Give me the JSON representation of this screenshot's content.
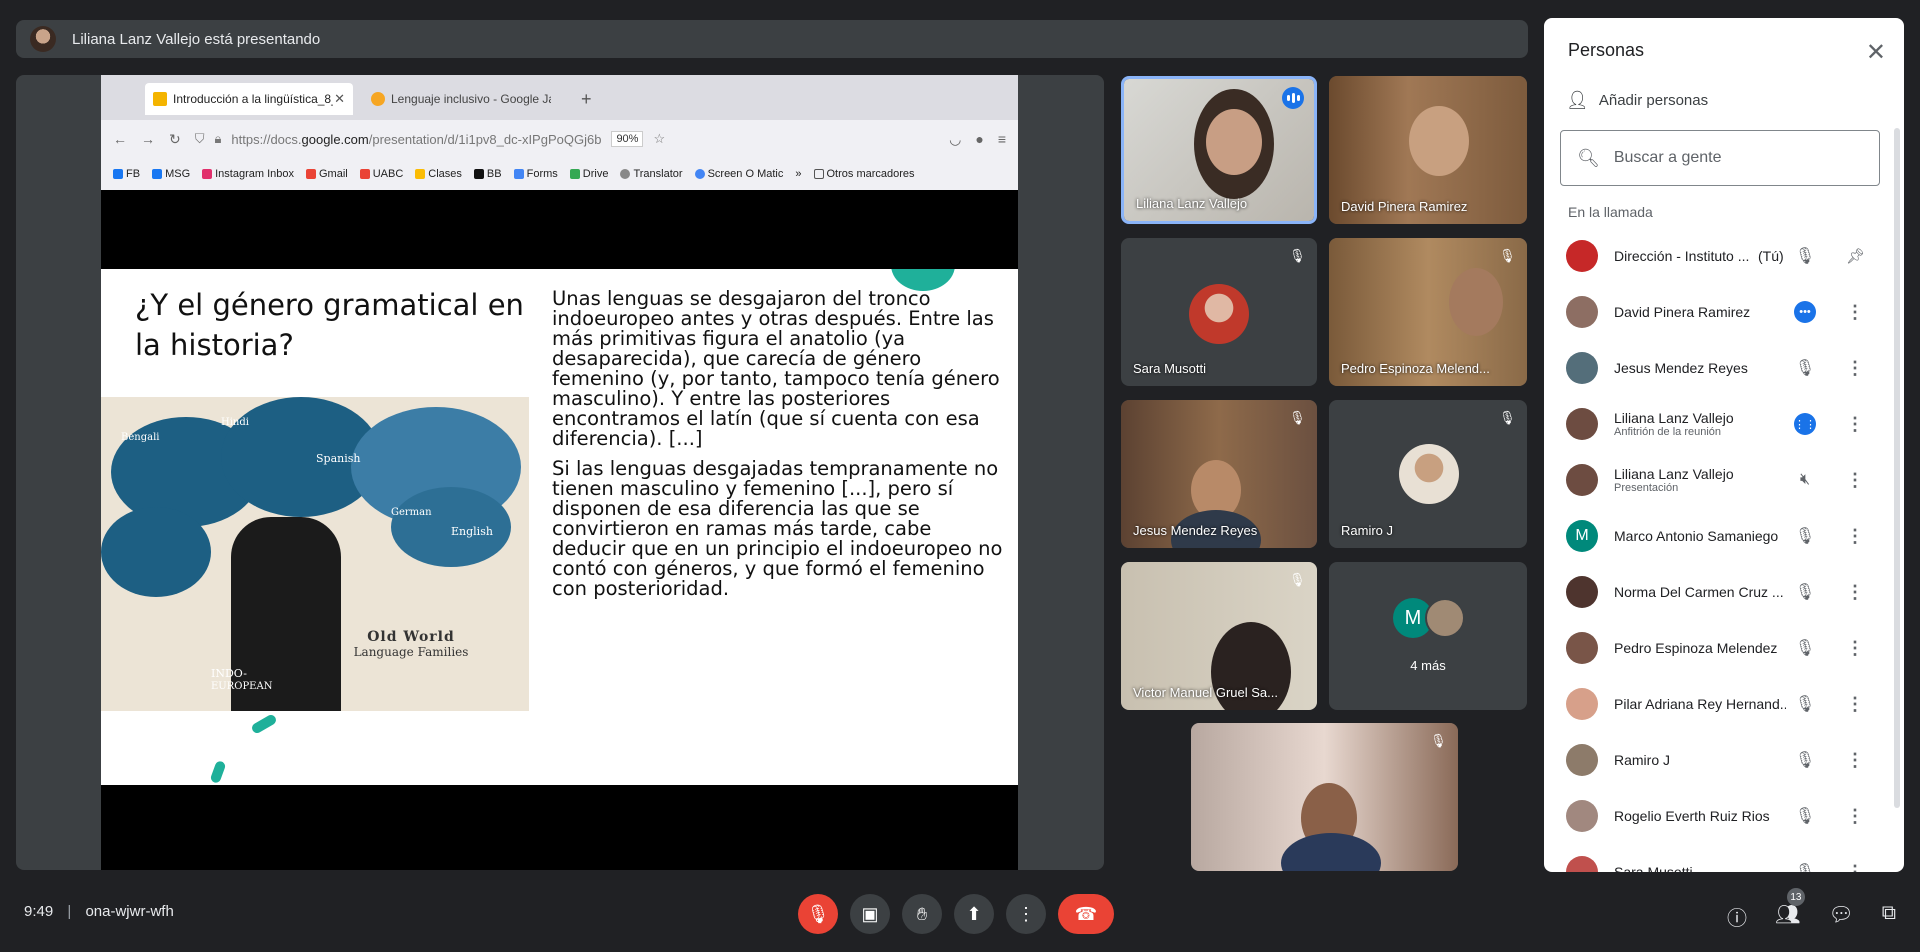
{
  "presenter_bar": {
    "text": "Liliana Lanz Vallejo está presentando"
  },
  "browser": {
    "tabs": [
      {
        "title": "Introducción a la lingüística_8_F",
        "active": true
      },
      {
        "title": "Lenguaje inclusivo - Google Jam",
        "active": false
      }
    ],
    "url": {
      "prefix": "https://docs.",
      "domain": "google.com",
      "rest": "/presentation/d/1i1pv8_dc-xIPgPoQGj6b"
    },
    "zoom": "90%",
    "bookmarks": [
      "FB",
      "MSG",
      "Instagram Inbox",
      "Gmail",
      "UABC",
      "Clases",
      "BB",
      "Forms",
      "Drive",
      "Translator",
      "Screen O Matic",
      "Otros marcadores"
    ]
  },
  "slide": {
    "title": "¿Y el género gramatical en la historia?",
    "paragraph1": "Unas lenguas se desgajaron del tronco indoeuropeo antes y otras después. Entre las más primitivas figura el anatolio (ya desaparecida), que carecía de género femenino (y, por tanto, tampoco tenía género masculino). Y entre las posteriores encontramos el latín (que sí cuenta con esa diferencia). [...]",
    "paragraph2": "Si las lenguas desgajadas tempranamente no tienen masculino y femenino [...], pero sí disponen de esa diferencia las que se convirtieron en ramas más tarde, cabe deducir que en un principio el indoeuropeo no contó con géneros, y que formó el femenino con posterioridad.",
    "image_labels": {
      "title": "Old World",
      "subtitle": "Language Families",
      "english": "English",
      "spanish": "Spanish",
      "german": "German",
      "hindi": "Hindi",
      "bengali": "Bengali",
      "indo": "INDO-",
      "european": "EUROPEAN"
    }
  },
  "tiles": [
    {
      "name": "Liliana Lanz Vallejo",
      "speaking": true
    },
    {
      "name": "David Pinera Ramirez"
    },
    {
      "name": "Sara Musotti",
      "muted": true
    },
    {
      "name": "Pedro Espinoza Melend...",
      "muted": true
    },
    {
      "name": "Jesus Mendez Reyes",
      "muted": true
    },
    {
      "name": "Ramiro J",
      "muted": true
    },
    {
      "name": "Victor Manuel Gruel Sa...",
      "muted": true
    },
    {
      "name": "4 más"
    }
  ],
  "more_initial": "M",
  "panel": {
    "title": "Personas",
    "add_people": "Añadir personas",
    "search_placeholder": "Buscar a gente",
    "section": "En la llamada",
    "people": [
      {
        "name": "Dirección - Instituto ...",
        "you": "(Tú)",
        "state": "muted",
        "pin": true,
        "color": "#c62828"
      },
      {
        "name": "David Pinera Ramirez",
        "state": "more",
        "color": "#8d6e63"
      },
      {
        "name": "Jesus Mendez Reyes",
        "state": "muted",
        "color": "#546e7a"
      },
      {
        "name": "Liliana Lanz Vallejo",
        "sub": "Anfitrión de la reunión",
        "state": "speaking",
        "color": "#6d4c41"
      },
      {
        "name": "Liliana Lanz Vallejo",
        "sub": "Presentación",
        "state": "audio-off",
        "color": "#6d4c41"
      },
      {
        "name": "Marco Antonio Samaniego",
        "initial": "M",
        "state": "muted",
        "color": "#00897b"
      },
      {
        "name": "Norma Del Carmen Cruz ...",
        "state": "muted",
        "color": "#4e342e"
      },
      {
        "name": "Pedro Espinoza Melendez",
        "state": "muted",
        "color": "#795548"
      },
      {
        "name": "Pilar Adriana Rey Hernand...",
        "state": "muted",
        "color": "#d7a08a"
      },
      {
        "name": "Ramiro J",
        "state": "muted",
        "color": "#8d7b6a"
      },
      {
        "name": "Rogelio Everth Ruiz Rios",
        "state": "muted",
        "color": "#a1887f"
      },
      {
        "name": "Sara Musotti",
        "state": "muted",
        "color": "#c0504d"
      }
    ]
  },
  "bottom": {
    "time": "9:49",
    "separator": "|",
    "meeting_code": "ona-wjwr-wfh",
    "participants_count": "13"
  }
}
